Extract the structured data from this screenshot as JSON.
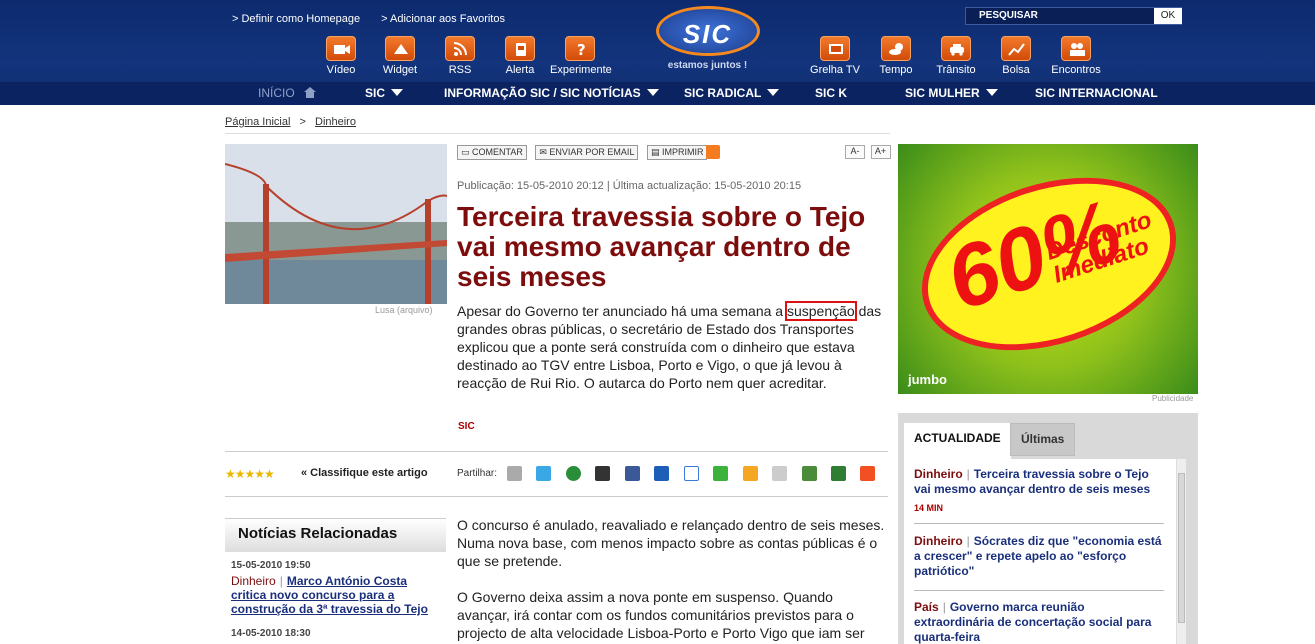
{
  "header": {
    "top_links": [
      "> Definir como Homepage",
      "> Adicionar aos Favoritos"
    ],
    "search_label": "PESQUISAR",
    "search_button": "OK",
    "logo_text": "SIC",
    "logo_tagline": "estamos juntos !",
    "tools_left": [
      "Vídeo",
      "Widget",
      "RSS",
      "Alerta",
      "Experimente"
    ],
    "tools_right": [
      "Grelha TV",
      "Tempo",
      "Trânsito",
      "Bolsa",
      "Encontros"
    ]
  },
  "nav": {
    "home": "INÍCIO",
    "items": [
      "SIC",
      "INFORMAÇÃO SIC / SIC NOTÍCIAS",
      "SIC RADICAL",
      "SIC K",
      "SIC MULHER",
      "SIC INTERNACIONAL"
    ]
  },
  "breadcrumb": {
    "home": "Página Inicial",
    "sep": ">",
    "current": "Dinheiro"
  },
  "article": {
    "photo_credit": "Lusa (arquivo)",
    "actions": [
      "COMENTAR",
      "ENVIAR POR EMAIL",
      "IMPRIMIR"
    ],
    "font_small": "A-",
    "font_large": "A+",
    "pubdate": "Publicação: 15-05-2010 20:12   |  Última actualização: 15-05-2010 20:15",
    "headline": "Terceira travessia sobre o Tejo vai mesmo avançar dentro de seis meses",
    "lead_before": "Apesar do Governo ter anunciado há uma semana a ",
    "lead_highlight": "suspenção",
    "lead_after": " das grandes obras públicas, o secretário de Estado dos Transportes explicou que a ponte será construída com o dinheiro que estava destinado ao TGV entre Lisboa, Porto e Vigo, o que já levou à reacção de Rui Rio. O autarca do Porto nem quer acreditar.",
    "source": "SIC",
    "stars": "★★★★★",
    "rate_label": "« Classifique este artigo",
    "share_label": "Partilhar:",
    "body": [
      "O concurso é anulado, reavaliado e relançado dentro de seis meses. Numa nova base, com menos impacto sobre as contas públicas é o que se pretende.",
      "O Governo deixa assim a nova ponte em suspenso. Quando avançar, irá contar com os fundos comunitários previstos para o projecto de alta velocidade Lisboa-Porto e Porto Vigo que iam ser"
    ]
  },
  "related": {
    "title": "Notícias Relacionadas",
    "items": [
      {
        "date": "15-05-2010 19:50",
        "category": "Dinheiro",
        "text": "Marco António Costa critica novo concurso para a construção da 3ª travessia do Tejo"
      },
      {
        "date": "14-05-2010 18:30",
        "category": "",
        "text": ""
      }
    ]
  },
  "ad": {
    "percent": "60%",
    "line1": "Desconto",
    "line2": "Imediato",
    "brand": "jumbo",
    "label": "Publicidade"
  },
  "news_box": {
    "tab_active": "ACTUALIDADE",
    "tab_inactive": "Últimas",
    "items": [
      {
        "category": "Dinheiro",
        "text": "Terceira travessia sobre o Tejo vai mesmo avançar dentro de seis meses",
        "time": "14 MIN"
      },
      {
        "category": "Dinheiro",
        "text": "Sócrates diz que \"economia está a crescer\" e repete apelo ao \"esforço patriótico\"",
        "time": ""
      },
      {
        "category": "País",
        "text": "Governo marca reunião extraordinária de concertação social para quarta-feira",
        "time": ""
      }
    ]
  }
}
